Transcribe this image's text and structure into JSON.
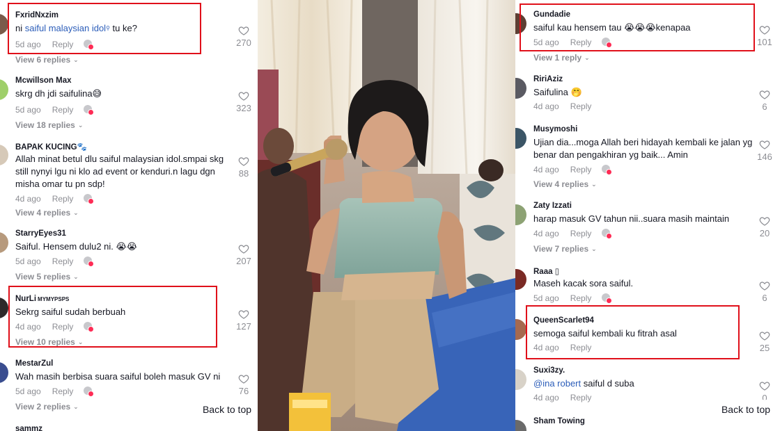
{
  "left": {
    "comments": [
      {
        "user": "FxridNxzim",
        "text_pre": "ni ",
        "mention": "saiful malaysian idol",
        "text_post": " tu ke?",
        "time": "5d ago",
        "reply": "Reply",
        "likes": "270",
        "view": "View 6 replies"
      },
      {
        "user": "Mcwillson Max",
        "text": "skrg dh jdi saifulina😅",
        "time": "5d ago",
        "reply": "Reply",
        "likes": "323",
        "view": "View 18 replies"
      },
      {
        "user": "BAPAK KUCING",
        "user_suffix": "🐾",
        "text": "Allah minat betul dlu saiful malaysian idol.smpai skg still nynyi lgu ni klo ad event or kenduri.n lagu dgn misha omar tu pn sdp!",
        "time": "4d ago",
        "reply": "Reply",
        "likes": "88",
        "view": "View 4 replies"
      },
      {
        "user": "StarryEyes31",
        "text": "Saiful. Hensem dulu2 ni. 😭😭",
        "time": "5d ago",
        "reply": "Reply",
        "likes": "207",
        "view": "View 5 replies"
      },
      {
        "user": "NurLi",
        "user_suffix": "MYMYPSPS",
        "text": "Sekrg saiful sudah berbuah",
        "time": "4d ago",
        "reply": "Reply",
        "likes": "127",
        "view": "View 10 replies"
      },
      {
        "user": "MestarZul",
        "text": "Wah masih berbisa suara saiful boleh masuk GV ni",
        "time": "5d ago",
        "reply": "Reply",
        "likes": "76",
        "view": "View 2 replies"
      },
      {
        "user": "sammz",
        "text": "",
        "time": "",
        "reply": "",
        "likes": "",
        "view": ""
      }
    ],
    "back_to_top": "Back to top"
  },
  "right": {
    "comments": [
      {
        "user": "Gundadie",
        "text": "saiful kau hensem tau 😭😭😭kenapaa",
        "time": "5d ago",
        "reply": "Reply",
        "likes": "101",
        "view": "View 1 reply"
      },
      {
        "user": "RiriAziz",
        "text": "Saifulina 🤭",
        "time": "4d ago",
        "reply": "Reply",
        "likes": "6",
        "view": ""
      },
      {
        "user": "Musymoshi",
        "text": "Ujian dia...moga Allah beri hidayah kembali ke jalan yg benar dan pengakhiran yg baik... Amin",
        "time": "4d ago",
        "reply": "Reply",
        "likes": "146",
        "view": "View 4 replies"
      },
      {
        "user": "Zaty Izzati",
        "text": "harap masuk GV tahun nii..suara masih maintain",
        "time": "4d ago",
        "reply": "Reply",
        "likes": "20",
        "view": "View 7 replies"
      },
      {
        "user": "Raaa",
        "user_suffix": "▯",
        "text": "Maseh kacak sora saiful.",
        "time": "5d ago",
        "reply": "Reply",
        "likes": "6",
        "view": ""
      },
      {
        "user": "QueenScarlet94",
        "text": "semoga saiful kembali ku fitrah asal",
        "time": "4d ago",
        "reply": "Reply",
        "likes": "25",
        "view": ""
      },
      {
        "user": "Suxi3zy.",
        "mention": "@ina robert",
        "text_post": " saiful d suba",
        "time": "4d ago",
        "reply": "Reply",
        "likes": "0",
        "view": ""
      },
      {
        "user": "Sham Towing",
        "text": "",
        "time": "",
        "reply": "",
        "likes": "",
        "view": ""
      }
    ],
    "back_to_top": "Back to top"
  },
  "colors": {
    "highlight": "#e0101a",
    "mention": "#2b5db9",
    "badge": "#fe2c55"
  }
}
